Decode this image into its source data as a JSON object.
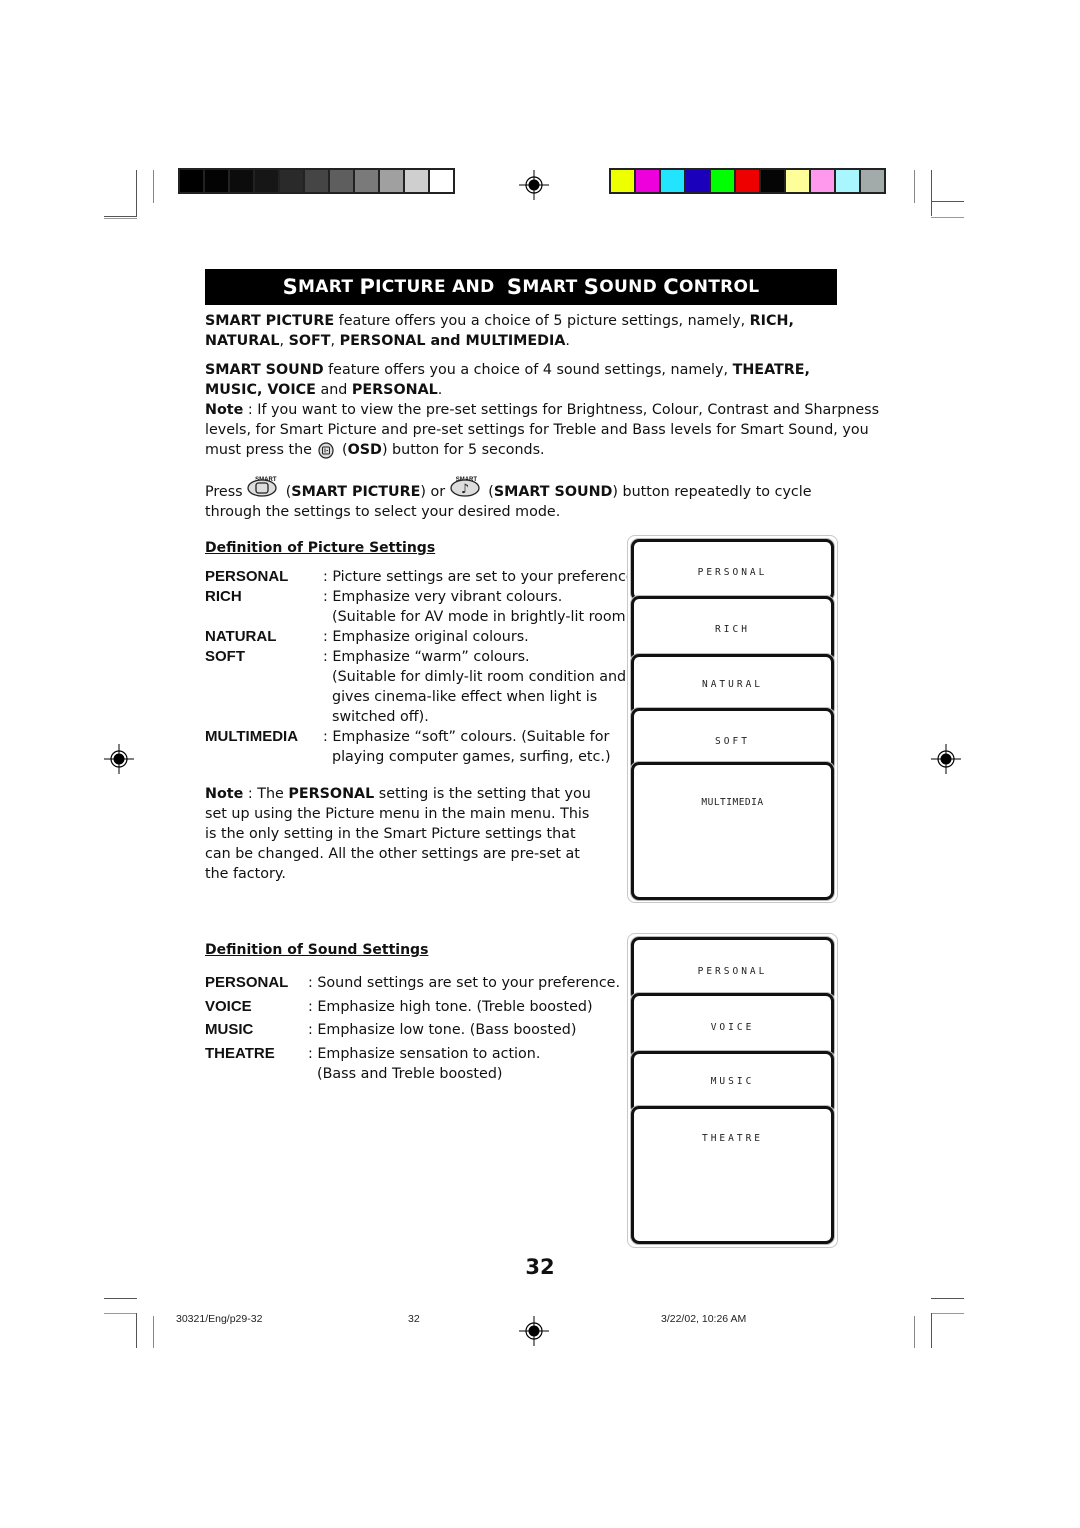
{
  "header": {
    "title_parts": [
      {
        "cap": "S",
        "rest": "MART "
      },
      {
        "cap": "P",
        "rest": "ICTURE AND  "
      },
      {
        "cap": "S",
        "rest": "MART "
      },
      {
        "cap": "S",
        "rest": "OUND "
      },
      {
        "cap": "C",
        "rest": "ONTROL"
      }
    ]
  },
  "color_bars": {
    "grayscale": [
      "#000000",
      "#030303",
      "#0c0c0c",
      "#161616",
      "#2a2a2a",
      "#454545",
      "#5e5e5e",
      "#7a7a7a",
      "#a0a0a0",
      "#cfcfcf",
      "#ffffff"
    ],
    "color": [
      "#eeff00",
      "#ee00dd",
      "#22e4ff",
      "#1a00bb",
      "#00ff00",
      "#ee0000",
      "#050505",
      "#ffff99",
      "#ff99ee",
      "#aaf6ff",
      "#a2abaa"
    ]
  },
  "intro": {
    "picture": {
      "b1": "SMART PICTURE",
      "t1": " feature offers you a choice of 5 picture settings, namely, ",
      "b2": "RICH,",
      "b3": "NATURAL",
      "t2": ",  ",
      "b4": "SOFT",
      "t3": ",  ",
      "b5": "PERSONAL and MULTIMEDIA",
      "t4": "."
    },
    "sound": {
      "b1": "SMART SOUND",
      "t1": " feature offers you a choice of 4 sound settings, namely, ",
      "b2": "THEATRE,",
      "b3": "MUSIC, VOICE",
      "t2": " and ",
      "b4": "PERSONAL",
      "t3": "."
    },
    "note": {
      "label": "Note",
      "line1": " : If you want to view the pre-set settings for Brightness, Colour, Contrast and Sharpness",
      "line2": "levels, for Smart Picture and pre-set settings for Treble and Bass levels for Smart Sound, you",
      "line3a": "must press the ",
      "osd_label": "OSD",
      "line3b": " button for 5 seconds."
    },
    "press": {
      "t1": "Press ",
      "smart_caption": "SMART",
      "b1": "SMART PICTURE",
      "t2": ") or ",
      "b2": "SMART SOUND",
      "t3": ") button repeatedly to cycle",
      "line2": "through the settings to select your desired mode."
    }
  },
  "picture_defs": {
    "title": "Definition of Picture Settings",
    "items": [
      {
        "term": "PERSONAL",
        "lines": [
          ": Picture settings are set to your preference."
        ]
      },
      {
        "term": "RICH",
        "lines": [
          ": Emphasize very vibrant colours.",
          "(Suitable for AV mode in brightly-lit room)"
        ]
      },
      {
        "term": "NATURAL",
        "lines": [
          ": Emphasize original colours."
        ]
      },
      {
        "term": "SOFT",
        "lines": [
          ": Emphasize “warm” colours.",
          "(Suitable for dimly-lit room condition and",
          "gives cinema-like effect when light is",
          "switched off)."
        ]
      },
      {
        "term": "MULTIMEDIA",
        "lines": [
          ": Emphasize “soft” colours. (Suitable for",
          "playing computer games, surfing, etc.)"
        ]
      }
    ],
    "note": {
      "label": "Note",
      "t1": " :  The ",
      "b1": "PERSONAL",
      "t2": " setting is the setting that you",
      "line2": "set up using the Picture menu in the main menu. This",
      "line3": "is the only setting in the Smart Picture settings that",
      "line4": "can be changed.  All the other settings are pre-set at",
      "line5": "the factory."
    },
    "screens": [
      "PERSONAL",
      "RICH",
      "NATURAL",
      "SOFT",
      "MULTIMEDIA"
    ]
  },
  "sound_defs": {
    "title": "Definition of Sound Settings",
    "items": [
      {
        "term": "PERSONAL",
        "lines": [
          ": Sound settings are set to your preference."
        ]
      },
      {
        "term": "VOICE",
        "lines": [
          ": Emphasize high tone. (Treble boosted)"
        ]
      },
      {
        "term": "MUSIC",
        "lines": [
          ": Emphasize low tone. (Bass boosted)"
        ]
      },
      {
        "term": "THEATRE",
        "lines": [
          ": Emphasize sensation to action.",
          "(Bass and Treble boosted)"
        ]
      }
    ],
    "screens": [
      "PERSONAL",
      "VOICE",
      "MUSIC",
      "THEATRE"
    ]
  },
  "page_number": "32",
  "footer": {
    "file": "30321/Eng/p29-32",
    "page": "32",
    "timestamp": "3/22/02, 10:26 AM"
  }
}
